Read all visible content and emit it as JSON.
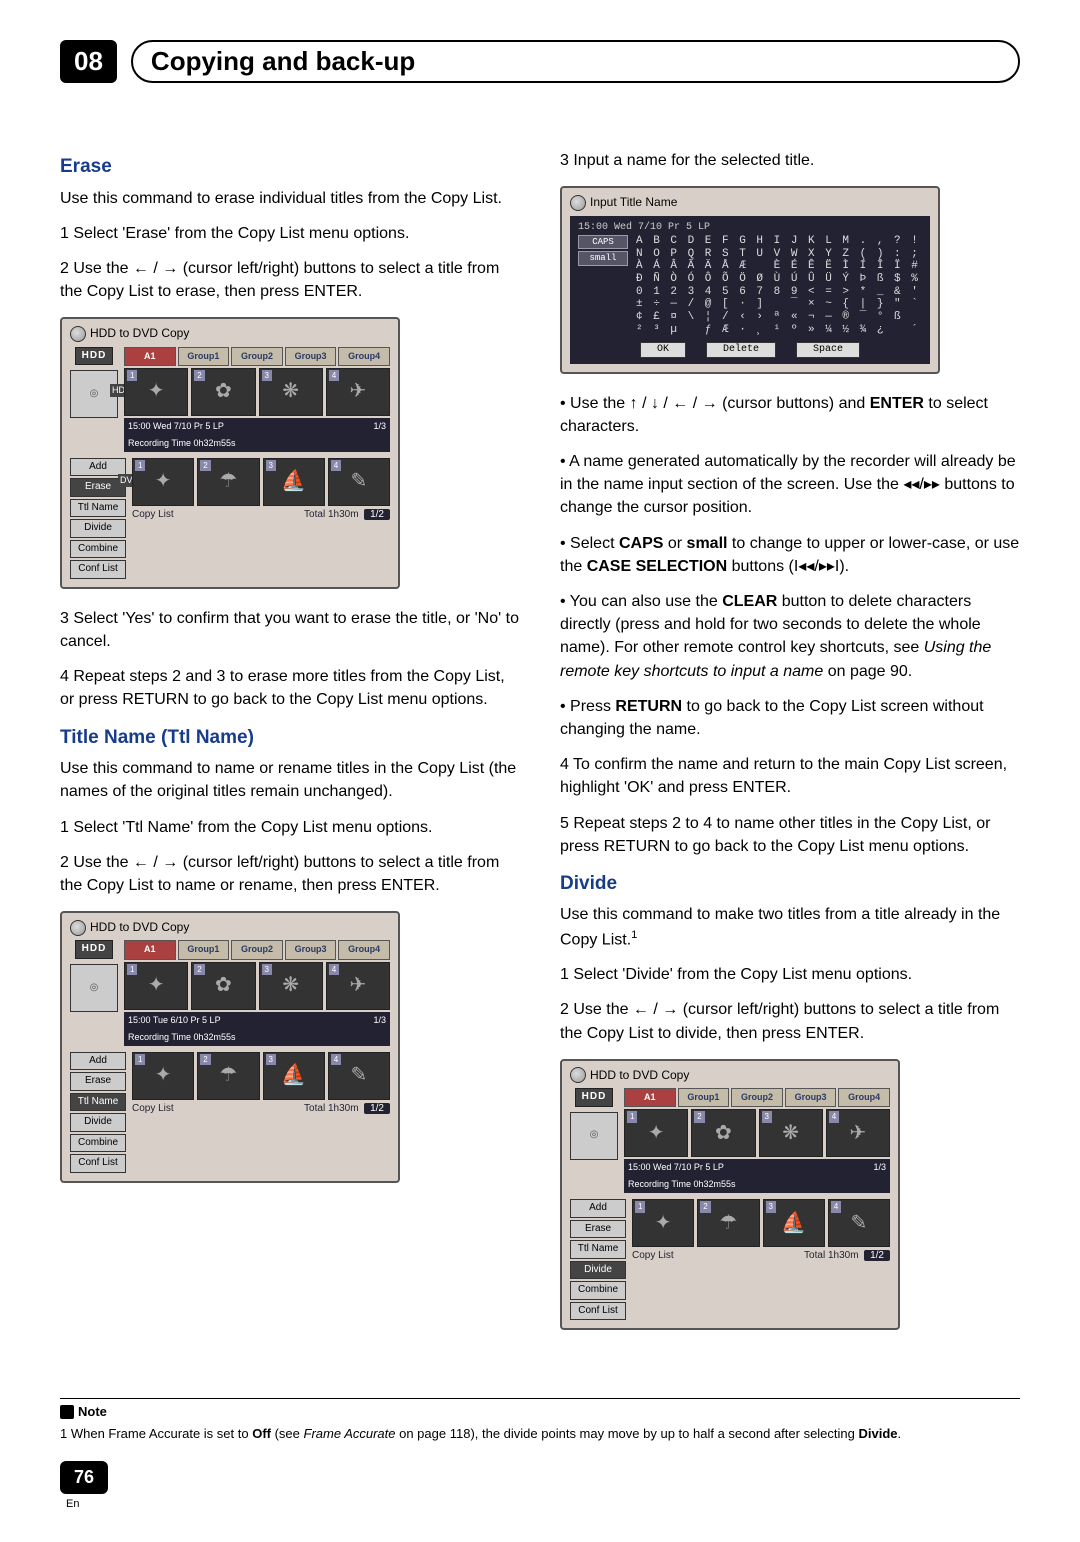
{
  "chapter": {
    "number": "08",
    "title": "Copying and back-up"
  },
  "left": {
    "erase": {
      "heading": "Erase",
      "intro": "Use this command to erase individual titles from the Copy List.",
      "s1": "1    Select 'Erase' from the Copy List menu options.",
      "s2": "2    Use the ← / → (cursor left/right) buttons to select a title from the Copy List to erase, then press ENTER.",
      "s3": "3    Select 'Yes' to confirm that you want to erase the title, or 'No' to cancel.",
      "s4": "4    Repeat steps 2 and 3 to erase more titles from the Copy List, or press RETURN to go back to the Copy List menu options."
    },
    "ttl": {
      "heading": "Title Name (Ttl Name)",
      "intro": "Use this command to name or rename titles in the Copy List (the names of the original titles remain unchanged).",
      "s1": "1    Select 'Ttl Name' from the Copy List menu options.",
      "s2": "2    Use the ← / → (cursor left/right) buttons to select a title from the Copy List to name or rename, then press ENTER."
    }
  },
  "right": {
    "s3": "3    Input a name for the selected title.",
    "bullets": {
      "b1a": "Use the ↑ / ↓ / ← / → (cursor buttons) and ",
      "b1b": "ENTER",
      "b1c": " to select characters.",
      "b2a": "A name generated automatically by the recorder will already be in the name input section of the screen. Use the ",
      "b2b": " buttons to change the cursor position.",
      "b3a": "Select ",
      "b3b": "CAPS",
      "b3c": " or ",
      "b3d": "small",
      "b3e": " to change to upper or lower-case, or use the ",
      "b3f": "CASE SELECTION",
      "b3g": " buttons (",
      "b3h": ").",
      "b4a": "You can also use the ",
      "b4b": "CLEAR",
      "b4c": " button to delete characters directly (press and hold for two seconds to delete the whole name). For other remote control key shortcuts, see ",
      "b4d": "Using the remote key shortcuts to input a name",
      "b4e": " on page 90.",
      "b5a": "Press ",
      "b5b": "RETURN",
      "b5c": " to go back to the Copy List screen without changing the name."
    },
    "s4": "4    To confirm the name and return to the main Copy List screen, highlight 'OK' and press ENTER.",
    "s5": "5    Repeat steps 2 to 4 to name other titles in the Copy List, or press RETURN to go back to the Copy List menu options.",
    "divide": {
      "heading": "Divide",
      "intro_a": "Use this command to make two titles from a title already in the Copy List.",
      "intro_sup": "1",
      "s1": "1    Select 'Divide' from the Copy List menu options.",
      "s2": "2    Use the ← / → (cursor left/right) buttons to select a title from the Copy List to divide, then press ENTER."
    }
  },
  "screens": {
    "copy_caption": "HDD to DVD Copy",
    "input_caption": "Input Title Name",
    "hdd": "HDD",
    "dvd": "DVD",
    "tabs": {
      "a1": "A1",
      "g1": "Group1",
      "g2": "Group2",
      "g3": "Group3",
      "g4": "Group4"
    },
    "side": {
      "add": "Add",
      "erase": "Erase",
      "ttl": "Ttl Name",
      "divide": "Divide",
      "combine": "Combine",
      "conf": "Conf List"
    },
    "info1_a": "15:00 Wed  7/10   Pr 5  LP",
    "info1_a2": "15:00 Tue  6/10   Pr 5  LP",
    "info1_b": "Recording Time        0h32m55s",
    "info_ratio": "1/3",
    "footer_cl": "Copy List",
    "footer_total": "Total  1h30m",
    "footer_ratio": "1/2",
    "input_title_bar": "15:00 Wed  7/10  Pr 5  LP",
    "caps": "CAPS",
    "small": "small",
    "char_lines": "A B C D E F G H I J K L M . , ? !\nN O P Q R S T U V W X Y Z ( ) : ;\nÀ Á Â Ã Ä Å Æ   È É Ê Ë Ì Í Î Ï #\nÐ Ñ Ò Ó Ô Õ Ö Ø Ù Ú Û Ü Ý Þ ß $ %\n0 1 2 3 4 5 6 7 8 9 < = > * _ & '\n± ÷ — / @ [ · ]   ¯ × ~ { | } \" `\n¢ £ ¤ \\ ¦ / ‹ › ª « ¬ — ® ¯ ° ß\n² ³ µ   ƒ Æ · ¸ ¹ º » ¼ ½ ¾ ¿   ´",
    "ok": "OK",
    "delete": "Delete",
    "space": "Space"
  },
  "note": {
    "label": "Note",
    "text_a": "1 When Frame Accurate is set to ",
    "text_b": "Off",
    "text_c": " (see ",
    "text_d": "Frame Accurate",
    "text_e": " on page 118), the divide points may move by up to half a second after selecting ",
    "text_f": "Divide",
    "text_g": "."
  },
  "page": {
    "number": "76",
    "lang": "En"
  }
}
